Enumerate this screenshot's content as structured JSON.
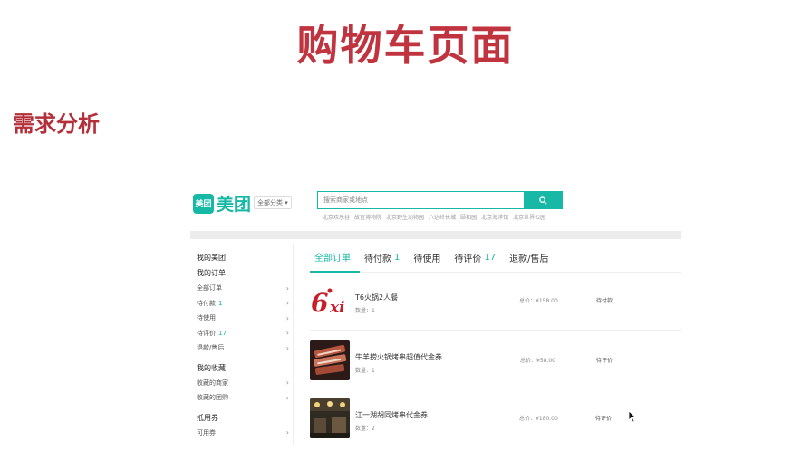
{
  "slide": {
    "title": "购物车页面",
    "subtitle": "需求分析"
  },
  "header": {
    "logo_icon_text": "美团",
    "logo_text": "美团",
    "city_label": "全部分类",
    "search_placeholder": "搜索商家或地点",
    "hot_words": [
      "北京欢乐谷",
      "故宫博物院",
      "北京野生动物园",
      "八达岭长城",
      "颐和园",
      "北京海洋馆",
      "北京世界公园"
    ]
  },
  "sidebar": {
    "my_meituan": "我的美团",
    "my_orders": "我的订单",
    "order_items": [
      {
        "label": "全部订单",
        "count": ""
      },
      {
        "label": "待付款",
        "count": "1"
      },
      {
        "label": "待使用",
        "count": ""
      },
      {
        "label": "待评价",
        "count": "17"
      },
      {
        "label": "退款/售后",
        "count": ""
      }
    ],
    "my_favorites": "我的收藏",
    "favorite_items": [
      {
        "label": "收藏的商家"
      },
      {
        "label": "收藏的团购"
      }
    ],
    "coupons": "抵用券",
    "coupon_items": [
      {
        "label": "可用券"
      }
    ]
  },
  "tabs": [
    {
      "label": "全部订单",
      "count": ""
    },
    {
      "label": "待付款",
      "count": "1"
    },
    {
      "label": "待使用",
      "count": ""
    },
    {
      "label": "待评价",
      "count": "17"
    },
    {
      "label": "退款/售后",
      "count": ""
    }
  ],
  "orders": [
    {
      "name": "T6火锅2人餐",
      "qty": "数量：1",
      "price": "总价：¥158.00",
      "status": "待付款",
      "thumb": "6xi-logo"
    },
    {
      "name": "牛羊捞火锅烤串超值代金券",
      "qty": "数量：1",
      "price": "总价：¥58.00",
      "status": "待评价",
      "thumb": "meat-photo"
    },
    {
      "name": "江一湖胡同烤串代金券",
      "qty": "数量：2",
      "price": "总价：¥180.00",
      "status": "待评价",
      "thumb": "restaurant-photo"
    }
  ],
  "colors": {
    "title": "#c0343f",
    "brand": "#17b8a6"
  }
}
